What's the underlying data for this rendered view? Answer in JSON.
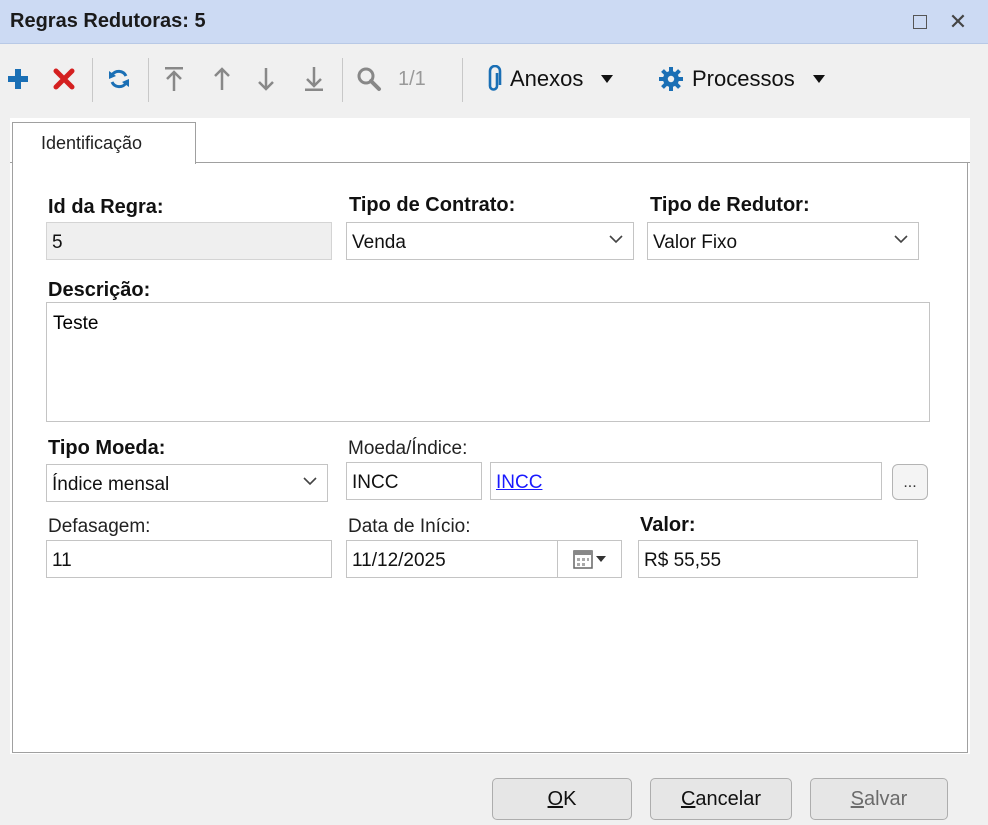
{
  "window": {
    "title": "Regras Redutoras: 5"
  },
  "toolbar": {
    "pager": "1/1",
    "attachments_label": "Anexos",
    "processes_label": "Processos"
  },
  "tabs": [
    {
      "label": "Identificação",
      "active": true
    }
  ],
  "form": {
    "rule_id": {
      "label": "Id da Regra:",
      "value": "5"
    },
    "contract_type": {
      "label": "Tipo de Contrato:",
      "value": "Venda"
    },
    "reducer_type": {
      "label": "Tipo de Redutor:",
      "value": "Valor Fixo"
    },
    "description": {
      "label": "Descrição:",
      "value": "Teste"
    },
    "currency_type": {
      "label": "Tipo Moeda:",
      "value": "Índice mensal"
    },
    "currency_index": {
      "label": "Moeda/Índice:",
      "code": "INCC",
      "name": "INCC",
      "lookup": "..."
    },
    "lag": {
      "label": "Defasagem:",
      "value": "11"
    },
    "start_date": {
      "label": "Data de Início:",
      "value": "11/12/2025"
    },
    "amount": {
      "label": "Valor:",
      "value": "R$ 55,55"
    }
  },
  "buttons": {
    "ok_mnemonic": "O",
    "ok_rest": "K",
    "cancel_mnemonic": "C",
    "cancel_rest": "ancelar",
    "save_mnemonic": "S",
    "save_rest": "alvar"
  },
  "colors": {
    "titlebar": "#ccdaf3",
    "add": "#1a6fb5",
    "delete": "#d42020",
    "link": "#1a1aff"
  }
}
